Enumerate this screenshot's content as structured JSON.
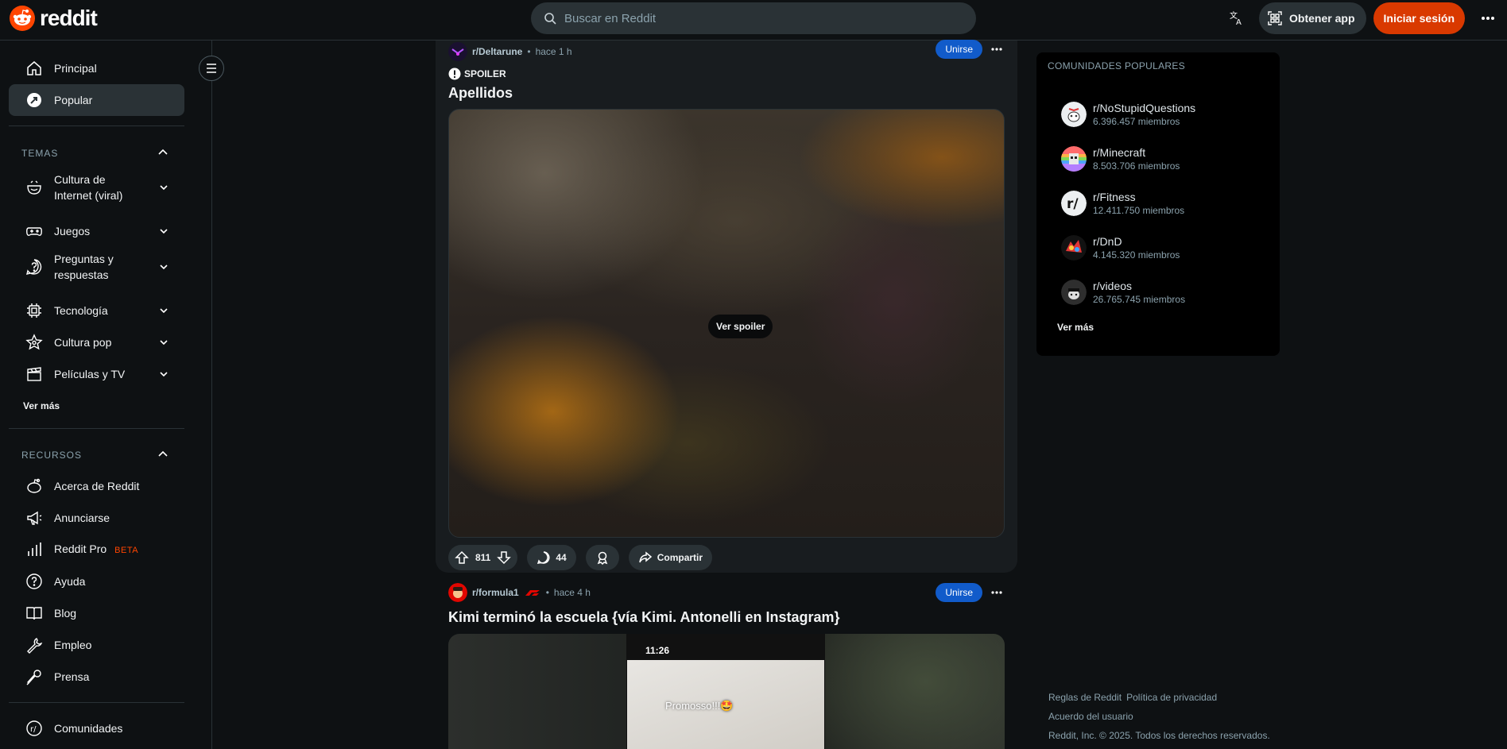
{
  "header": {
    "logo_text": "reddit",
    "search_placeholder": "Buscar en Reddit",
    "get_app_label": "Obtener app",
    "login_label": "Iniciar sesión",
    "brand_color": "#ff4500",
    "login_color": "#d93900"
  },
  "sidebar": {
    "primary": [
      {
        "label": "Principal",
        "icon": "home-icon"
      },
      {
        "label": "Popular",
        "icon": "popular-icon",
        "active": true
      }
    ],
    "topics_title": "TEMAS",
    "topics": [
      {
        "label": "Cultura de Internet (viral)",
        "icon": "internet-culture-icon"
      },
      {
        "label": "Juegos",
        "icon": "gamepad-icon"
      },
      {
        "label": "Preguntas y respuestas",
        "icon": "question-icon"
      },
      {
        "label": "Tecnología",
        "icon": "chip-icon"
      },
      {
        "label": "Cultura pop",
        "icon": "star-icon"
      },
      {
        "label": "Películas y TV",
        "icon": "clapperboard-icon"
      }
    ],
    "topics_more": "Ver más",
    "resources_title": "RECURSOS",
    "resources": [
      {
        "label": "Acerca de Reddit",
        "icon": "reddit-alien-icon"
      },
      {
        "label": "Anunciarse",
        "icon": "megaphone-icon"
      },
      {
        "label": "Reddit Pro",
        "badge": "BETA",
        "icon": "bar-chart-icon"
      },
      {
        "label": "Ayuda",
        "icon": "help-icon"
      },
      {
        "label": "Blog",
        "icon": "book-icon"
      },
      {
        "label": "Empleo",
        "icon": "wrench-icon"
      },
      {
        "label": "Prensa",
        "icon": "microphone-icon"
      }
    ],
    "communities_label": "Comunidades"
  },
  "posts": [
    {
      "subreddit": "r/Deltarune",
      "time": "hace 1 h",
      "join_label": "Unirse",
      "tag": "SPOILER",
      "title": "Apellidos",
      "spoiler_button": "Ver spoiler",
      "votes": "811",
      "comments": "44",
      "share_label": "Compartir"
    },
    {
      "subreddit": "r/formula1",
      "time": "hace 4 h",
      "join_label": "Unirse",
      "title": "Kimi terminó la escuela {vía Kimi. Antonelli en Instagram}",
      "phone_time": "11:26",
      "phone_caption": "Promosso!!!🤩"
    }
  ],
  "rail": {
    "title": "COMUNIDADES POPULARES",
    "communities": [
      {
        "name": "r/NoStupidQuestions",
        "members": "6.396.457 miembros"
      },
      {
        "name": "r/Minecraft",
        "members": "8.503.706 miembros"
      },
      {
        "name": "r/Fitness",
        "members": "12.411.750 miembros"
      },
      {
        "name": "r/DnD",
        "members": "4.145.320 miembros"
      },
      {
        "name": "r/videos",
        "members": "26.765.745 miembros"
      }
    ],
    "more_label": "Ver más"
  },
  "footer": {
    "rules": "Reglas de Reddit",
    "privacy": "Política de privacidad",
    "user_agreement": "Acuerdo del usuario",
    "copyright": "Reddit, Inc. © 2025. Todos los derechos reservados."
  }
}
